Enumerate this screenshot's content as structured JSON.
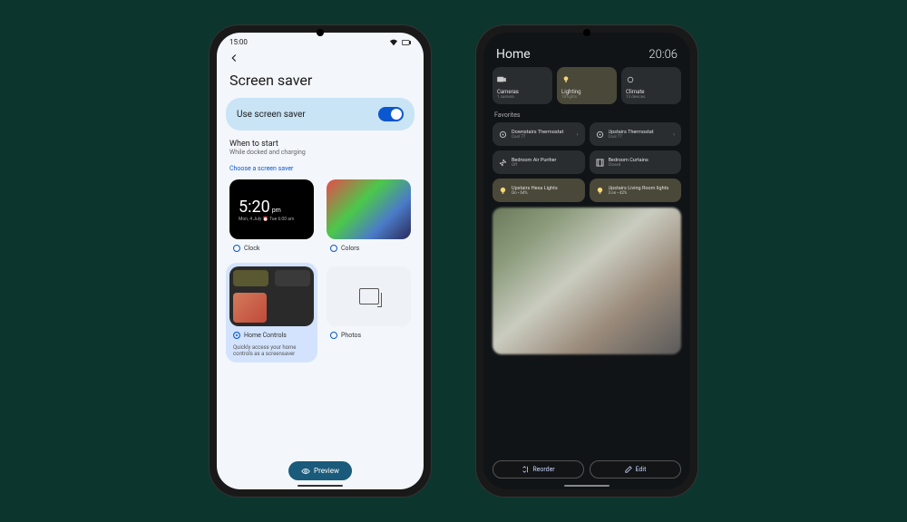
{
  "phone1": {
    "status_time": "15:00",
    "back_icon": "arrow-left",
    "title": "Screen saver",
    "toggle": {
      "label": "Use screen saver",
      "on": true
    },
    "when": {
      "title": "When to start",
      "sub": "While docked and charging"
    },
    "choose_label": "Choose a screen saver",
    "savers": {
      "clock": {
        "label": "Clock",
        "time": "5:20",
        "ampm": "pm",
        "date": "Mon, 4 July ⏰ Tue 6:00 am"
      },
      "colors": {
        "label": "Colors"
      },
      "home": {
        "label": "Home Controls",
        "desc": "Quickly access your home controls as a screensaver"
      },
      "photos": {
        "label": "Photos"
      }
    },
    "preview_btn": "Preview"
  },
  "phone2": {
    "title": "Home",
    "time": "20:06",
    "categories": [
      {
        "name": "Cameras",
        "sub": "1 camera",
        "active": false
      },
      {
        "name": "Lighting",
        "sub": "18 lights",
        "active": true
      },
      {
        "name": "Climate",
        "sub": "13 devices",
        "active": false
      }
    ],
    "favorites_label": "Favorites",
    "favorites": [
      {
        "name": "Downstairs Thermostat",
        "sub": "Cool 77",
        "lit": false,
        "chevron": true,
        "icon": "thermostat"
      },
      {
        "name": "Upstairs Thermostat",
        "sub": "Cool 77",
        "lit": false,
        "chevron": true,
        "icon": "thermostat"
      },
      {
        "name": "Bedroom Air Purifier",
        "sub": "Off",
        "lit": false,
        "chevron": false,
        "icon": "fan"
      },
      {
        "name": "Bedroom Curtains",
        "sub": "Closed",
        "lit": false,
        "chevron": false,
        "icon": "curtain"
      },
      {
        "name": "Upstairs Hexa Lights",
        "sub": "On • 64%",
        "lit": true,
        "chevron": false,
        "icon": "bulb"
      },
      {
        "name": "Upstairs Living Room lights",
        "sub": "3 on • 42%",
        "lit": true,
        "chevron": false,
        "icon": "bulb"
      }
    ],
    "reorder_btn": "Reorder",
    "edit_btn": "Edit"
  }
}
